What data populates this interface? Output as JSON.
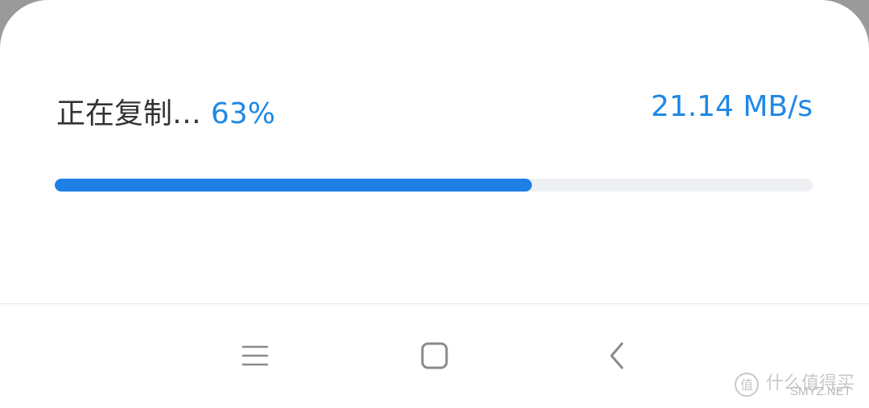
{
  "copy_dialog": {
    "status_label": "正在复制…",
    "percent_text": "63%",
    "speed_text": "21.14 MB/s",
    "progress_fraction": 0.63,
    "accent_color": "#1e88e5",
    "progress_color": "#1e7fe6",
    "track_color": "#eef0f3"
  },
  "nav_bar": {
    "icons": [
      "menu-icon",
      "home-icon",
      "back-icon"
    ]
  },
  "watermark": {
    "text_cn": "什么值得买",
    "text_en": "SMYZ.NET"
  }
}
